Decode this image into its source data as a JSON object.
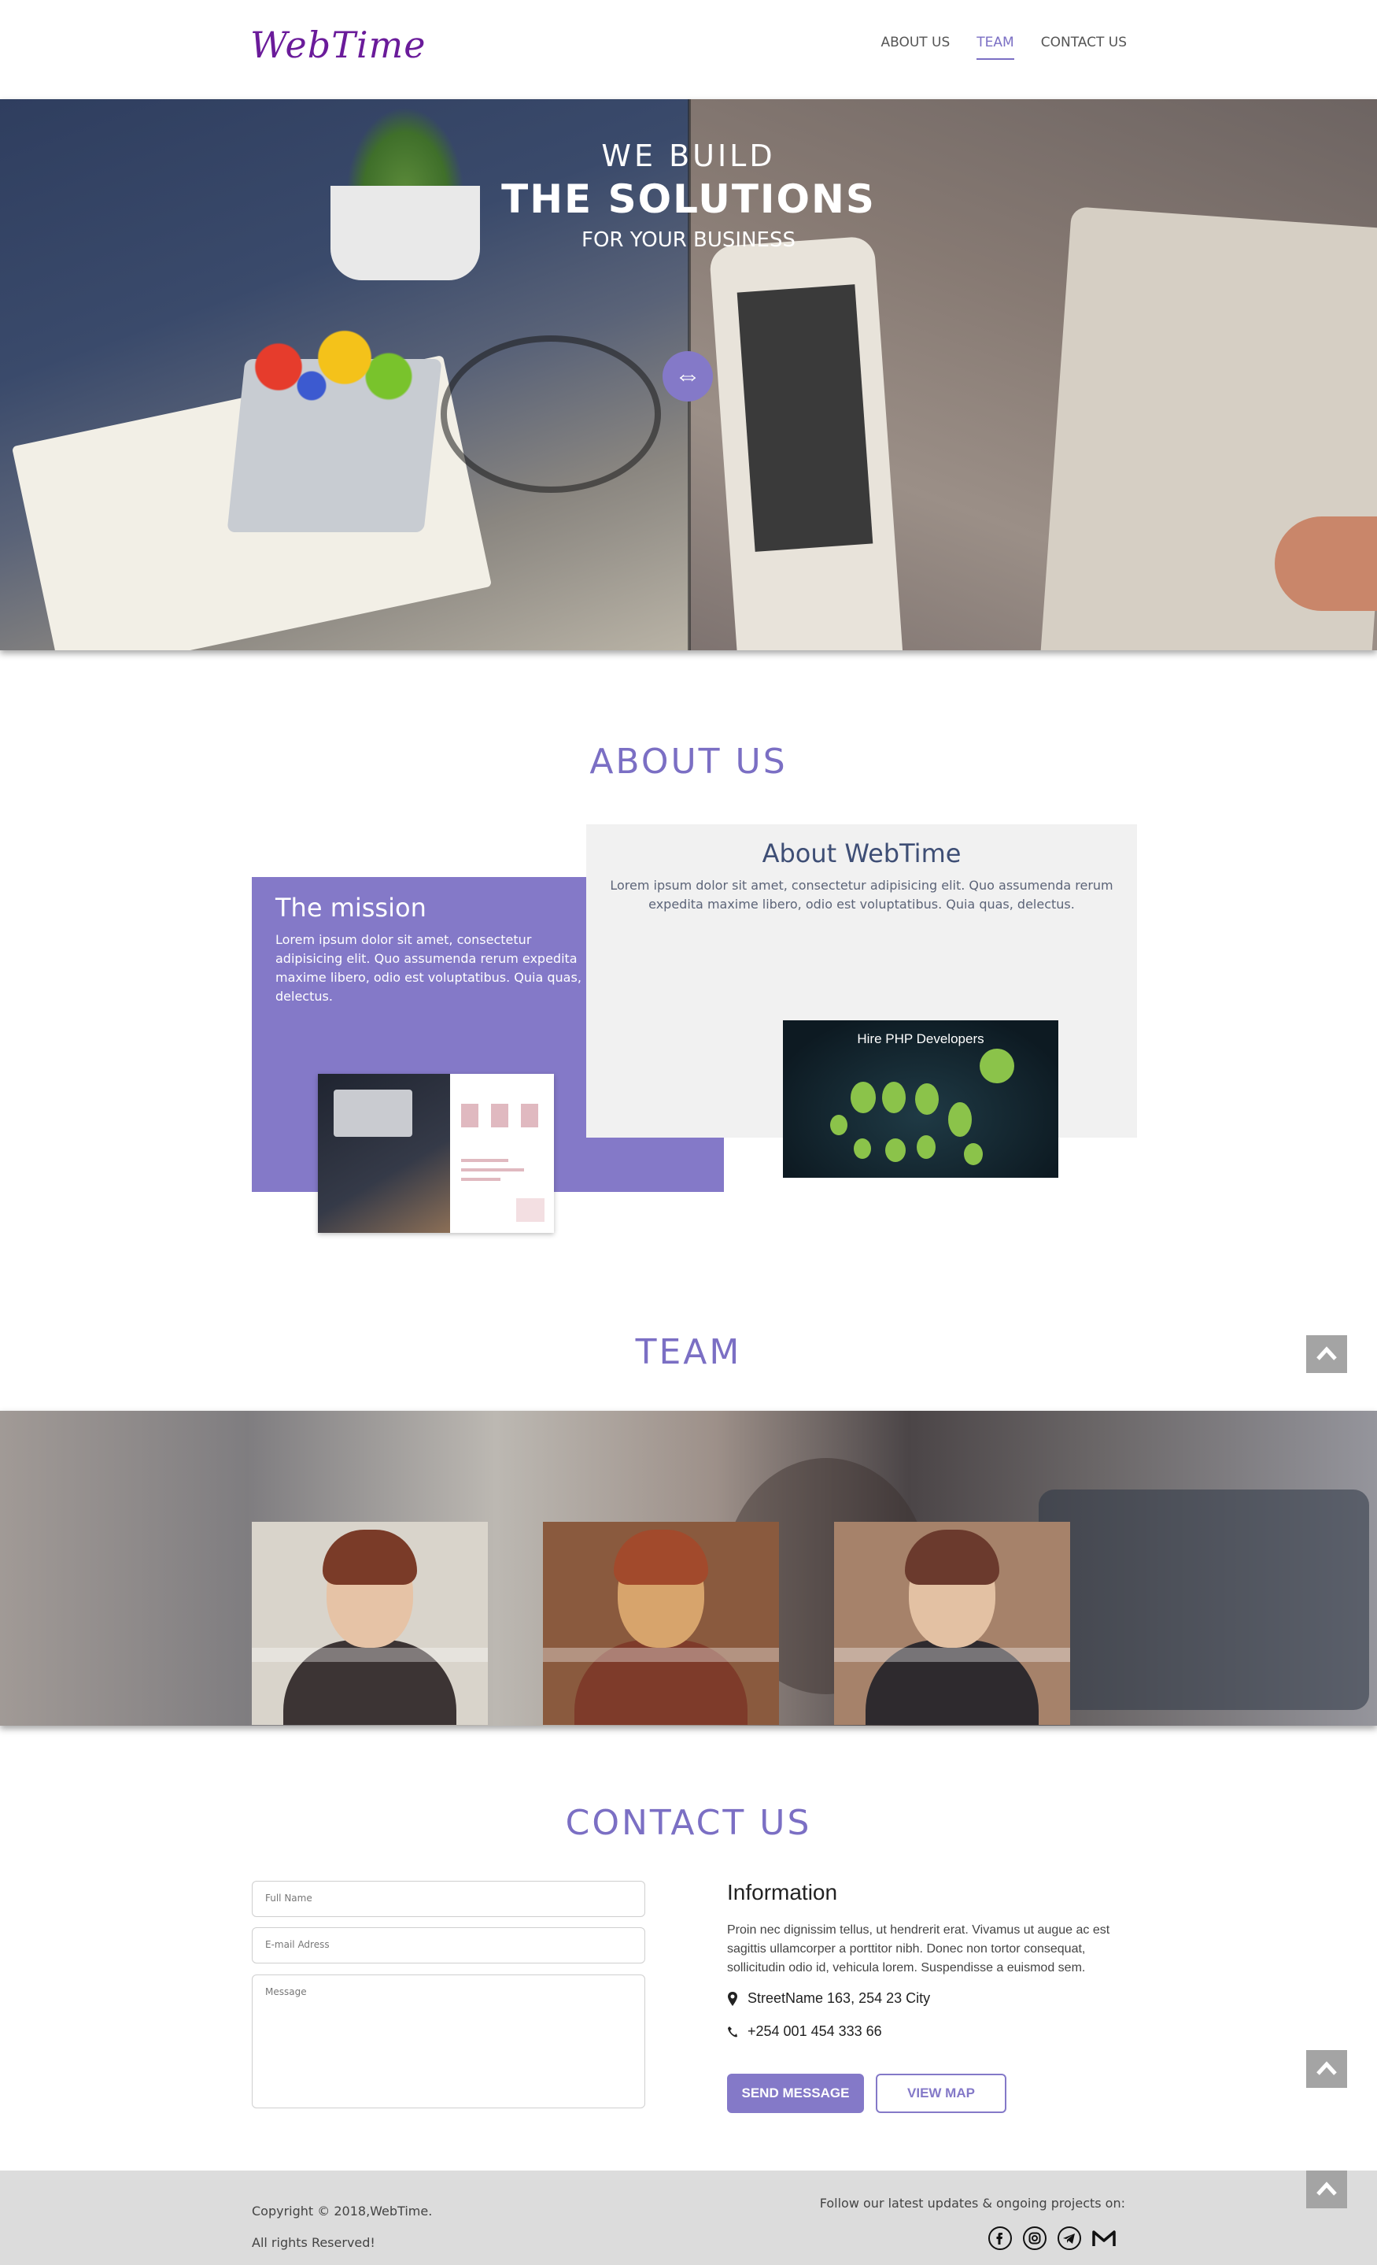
{
  "brand": {
    "logo": "WebTime",
    "accent": "#8479c8",
    "title_color": "#7b6fc4"
  },
  "nav": {
    "items": [
      "ABOUT US",
      "TEAM",
      "CONTACT US"
    ],
    "active": "TEAM"
  },
  "hero": {
    "line1": "WE BUILD",
    "line2": "THE SOLUTIONS",
    "line3": "FOR YOUR BUSINESS",
    "handle_glyph": "⇔"
  },
  "about": {
    "title": "ABOUT US",
    "webtime_heading": "About WebTime",
    "webtime_text": "Lorem ipsum dolor sit amet, consectetur adipisicing elit. Quo assumenda rerum expedita maxime libero, odio est voluptatibus. Quia quas, delectus.",
    "mission_heading": "The mission",
    "mission_text": "Lorem ipsum dolor sit amet, consectetur adipisicing elit. Quo assumenda rerum expedita maxime libero, odio est voluptatibus. Quia quas, delectus.",
    "php_image_title": "Hire PHP Developers"
  },
  "team": {
    "title": "TEAM",
    "members": [
      "member-1",
      "member-2",
      "member-3"
    ]
  },
  "contact": {
    "title": "CONTACT US",
    "fullname_placeholder": "Full Name",
    "email_placeholder": "E-mail Adress",
    "message_placeholder": "Message",
    "info_heading": "Information",
    "info_text": "Proin nec dignissim tellus, ut hendrerit erat. Vivamus ut augue ac est sagittis ullamcorper a porttitor nibh. Donec non tortor consequat, sollicitudin odio id, vehicula lorem. Suspendisse a euismod sem.",
    "address": "StreetName 163, 254 23 City",
    "phone": "+254 001 454 333 66",
    "send_label": "SEND MESSAGE",
    "map_label": "VIEW MAP"
  },
  "footer": {
    "copyright": "Copyright © 2018,WebTime.",
    "rights": "All rights Reserved!",
    "follow": "Follow our latest updates & ongoing projects on:",
    "socials": [
      "facebook-icon",
      "instagram-icon",
      "telegram-icon",
      "gmail-icon"
    ]
  }
}
